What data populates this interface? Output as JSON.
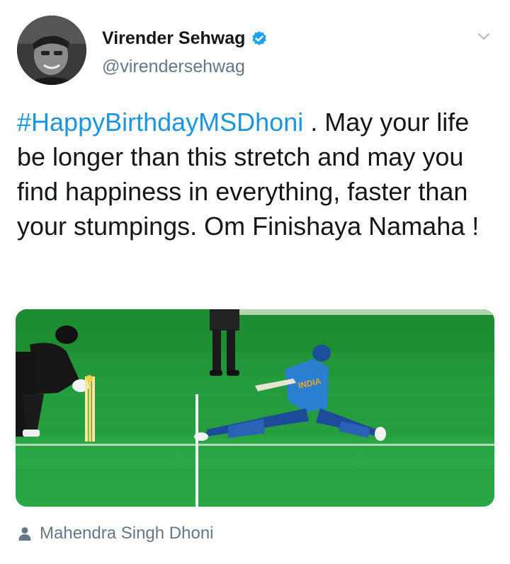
{
  "author": {
    "display_name": "Virender Sehwag",
    "handle": "@virendersehwag",
    "verified": true,
    "verified_icon": "verified-badge-icon",
    "avatar_icon": "profile-avatar"
  },
  "menu": {
    "icon": "chevron-down-icon"
  },
  "tweet": {
    "hashtag": "#HappyBirthdayMSDhoni",
    "text": " . May your life be longer than this stretch and may you find happiness in everything, faster than your stumpings. Om Finishaya Namaha !",
    "hashtag_color": "#1b95e0"
  },
  "media": {
    "jersey_text": "INDIA"
  },
  "tagged": {
    "icon": "person-icon",
    "name": "Mahendra Singh Dhoni"
  }
}
